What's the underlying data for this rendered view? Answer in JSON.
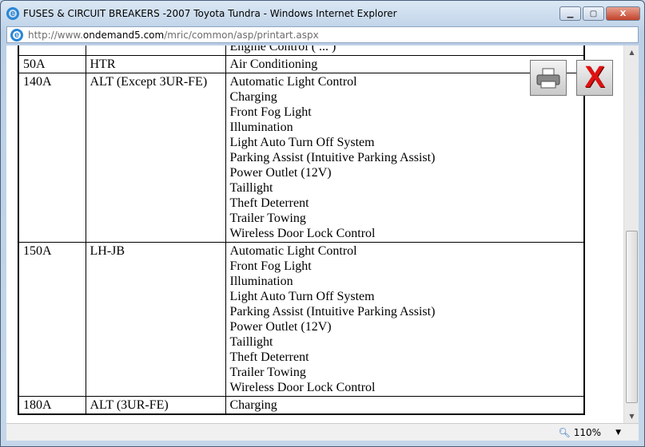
{
  "window": {
    "title": "FUSES & CIRCUIT BREAKERS -2007 Toyota Tundra - Windows Internet Explorer",
    "url_prefix": "http://www.",
    "url_domain": "ondemand5.com",
    "url_path": "/mric/common/asp/printart.aspx"
  },
  "rows": [
    {
      "amp": "",
      "name": "",
      "circuits": [
        "Engine Control ( ... )"
      ]
    },
    {
      "amp": "50A",
      "name": "HTR",
      "circuits": [
        "Air Conditioning"
      ]
    },
    {
      "amp": "140A",
      "name": "ALT (Except 3UR-FE)",
      "circuits": [
        "Automatic Light Control",
        "Charging",
        "Front Fog Light",
        "Illumination",
        "Light Auto Turn Off System",
        "Parking Assist (Intuitive Parking Assist)",
        "Power Outlet (12V)",
        "Taillight",
        "Theft Deterrent",
        "Trailer Towing",
        "Wireless Door Lock Control"
      ]
    },
    {
      "amp": "150A",
      "name": "LH-JB",
      "circuits": [
        "Automatic Light Control",
        "Front Fog Light",
        "Illumination",
        "Light Auto Turn Off System",
        "Parking Assist (Intuitive Parking Assist)",
        "Power Outlet (12V)",
        "Taillight",
        "Theft Deterrent",
        "Trailer Towing",
        "Wireless Door Lock Control"
      ]
    },
    {
      "amp": "180A",
      "name": "ALT (3UR-FE)",
      "circuits": [
        "Charging"
      ]
    }
  ],
  "status": {
    "zoom": "110%"
  }
}
